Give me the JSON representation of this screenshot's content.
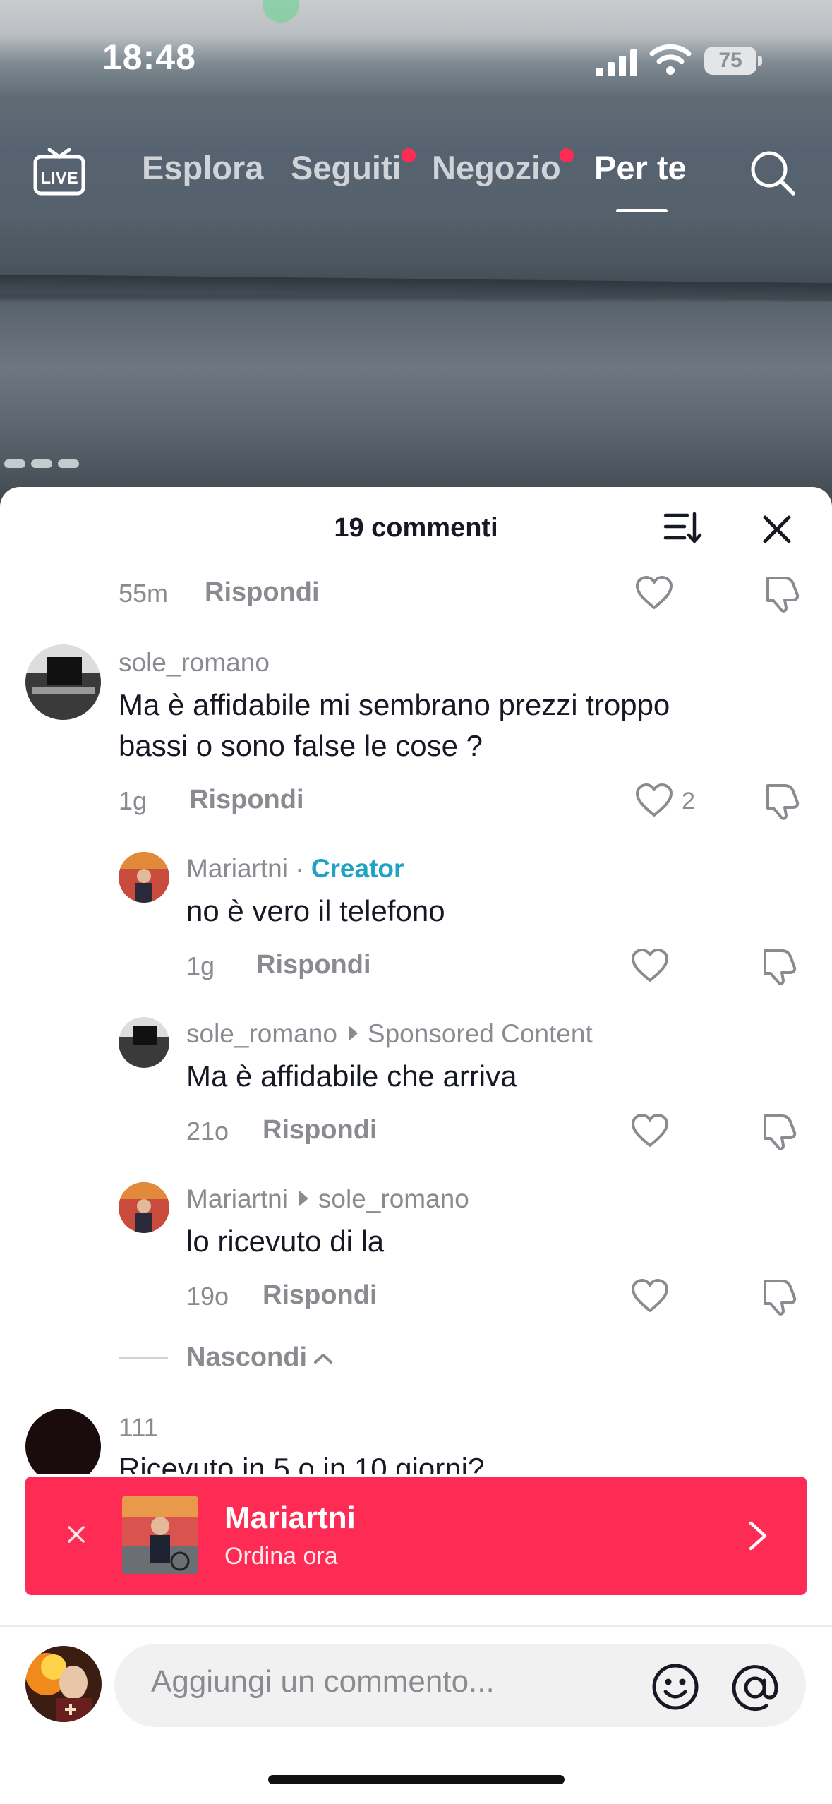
{
  "status_bar": {
    "time": "18:48",
    "battery": "75"
  },
  "top_nav": {
    "live": "LIVE",
    "tabs": [
      {
        "label": "Esplora"
      },
      {
        "label": "Seguiti"
      },
      {
        "label": "Negozio"
      },
      {
        "label": "Per te"
      }
    ],
    "active_tab": "Per te"
  },
  "comments_sheet": {
    "title": "19 commenti",
    "comments": [
      {
        "id": "c0",
        "time": "55m",
        "reply_label": "Rispondi",
        "likes": ""
      },
      {
        "id": "c1",
        "username": "sole_romano",
        "text_line1": "Ma è affidabile mi sembrano prezzi troppo",
        "text_line2": "bassi o sono false le cose ?",
        "time": "1g",
        "reply_label": "Rispondi",
        "likes": "2"
      },
      {
        "id": "r1",
        "username": "Mariartni",
        "separator": " · ",
        "badge": "Creator",
        "text": "no è vero il telefono",
        "time": "1g",
        "reply_label": "Rispondi"
      },
      {
        "id": "r2",
        "username": "sole_romano",
        "reply_to": "Sponsored Content",
        "text": "Ma è affidabile che arriva",
        "time": "21o",
        "reply_label": "Rispondi"
      },
      {
        "id": "r3",
        "username": "Mariartni",
        "reply_to": "sole_romano",
        "text": "lo ricevuto di la",
        "time": "19o",
        "reply_label": "Rispondi"
      },
      {
        "id": "c2",
        "username": "111",
        "text": "Ricevuto in 5 o in 10 giorni?"
      }
    ],
    "hide_label": "Nascondi"
  },
  "promo_banner": {
    "name": "Mariartni",
    "subtitle": "Ordina ora",
    "color": "#fe2c55"
  },
  "comment_input": {
    "placeholder": "Aggiungi un commento..."
  },
  "colors": {
    "accent": "#fe2c55",
    "creator": "#20a2c4",
    "muted": "#8a8b91",
    "text": "#161823"
  },
  "icons": [
    "live-icon",
    "search-icon",
    "sort-icon",
    "close-icon",
    "heart-icon",
    "dislike-icon",
    "emoji-icon",
    "at-icon",
    "chevron-right-icon",
    "chevron-up-icon"
  ]
}
